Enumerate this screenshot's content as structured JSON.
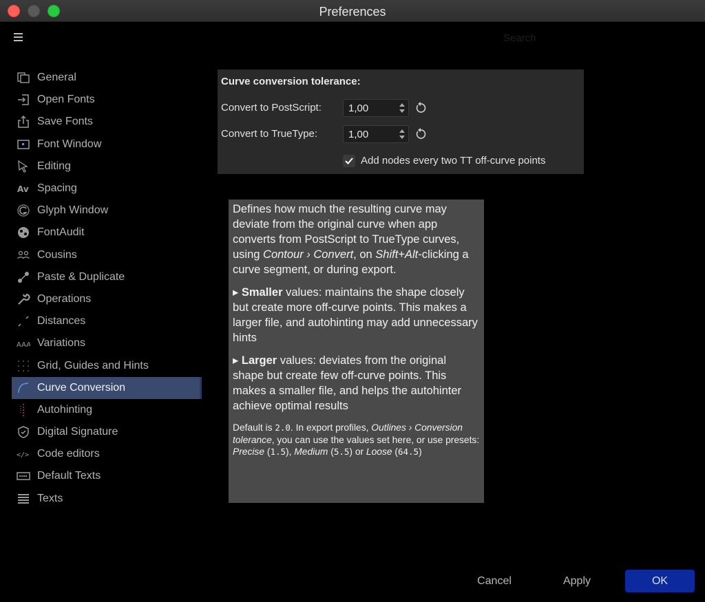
{
  "window": {
    "title": "Preferences"
  },
  "search": {
    "placeholder": "Search"
  },
  "sidebar": {
    "items": [
      {
        "label": "General",
        "icon": "general-icon"
      },
      {
        "label": "Open Fonts",
        "icon": "open-fonts-icon"
      },
      {
        "label": "Save Fonts",
        "icon": "save-fonts-icon"
      },
      {
        "label": "Font Window",
        "icon": "font-window-icon"
      },
      {
        "label": "Editing",
        "icon": "editing-icon"
      },
      {
        "label": "Spacing",
        "icon": "spacing-icon"
      },
      {
        "label": "Glyph Window",
        "icon": "glyph-window-icon"
      },
      {
        "label": "FontAudit",
        "icon": "fontaudit-icon"
      },
      {
        "label": "Cousins",
        "icon": "cousins-icon"
      },
      {
        "label": "Paste & Duplicate",
        "icon": "paste-duplicate-icon"
      },
      {
        "label": "Operations",
        "icon": "wrench-icon"
      },
      {
        "label": "Distances",
        "icon": "distances-icon"
      },
      {
        "label": "Variations",
        "icon": "variations-icon"
      },
      {
        "label": "Grid, Guides and Hints",
        "icon": "grid-icon"
      },
      {
        "label": "Curve Conversion",
        "icon": "curve-conversion-icon",
        "active": true
      },
      {
        "label": "Autohinting",
        "icon": "autohinting-icon"
      },
      {
        "label": "Digital Signature",
        "icon": "shield-check-icon"
      },
      {
        "label": "Code editors",
        "icon": "code-icon"
      },
      {
        "label": "Default Texts",
        "icon": "default-texts-icon"
      },
      {
        "label": "Texts",
        "icon": "texts-icon"
      }
    ]
  },
  "panel": {
    "heading": "Curve conversion tolerance:",
    "postscript": {
      "label": "Convert to PostScript:",
      "value": "1,00"
    },
    "truetype": {
      "label": "Convert to TrueType:",
      "value": "1,00"
    },
    "add_nodes": {
      "label": "Add nodes every two TT off-curve points",
      "checked": true
    }
  },
  "tooltip": {
    "p1_a": "Defines how much the resulting curve may deviate from the original curve when app converts from PostScript to TrueType curves, using ",
    "p1_em1": "Contour › Convert",
    "p1_b": ", on ",
    "p1_em2": "Shift+Alt",
    "p1_c": "-clicking a curve segment, or during export.",
    "p2_bullet": "▸ ",
    "p2_bold": "Smaller",
    "p2_rest": " values: maintains the shape closely but create more off-curve points. This makes a larger file, and autohinting may add unnecessary hints",
    "p3_bullet": "▸ ",
    "p3_bold": "Larger",
    "p3_rest": " values: deviates from the original shape but create few off-curve points. This makes a smaller file, and helps the autohinter achieve optimal results",
    "p4_a": "Default is ",
    "p4_code1": "2.0",
    "p4_b": ". In export profiles, ",
    "p4_em1": "Outlines › Conversion tolerance",
    "p4_c": ", you can use the values set here, or use presets: ",
    "p4_em2": "Precise",
    "p4_d": " (",
    "p4_code2": "1.5",
    "p4_e": "), ",
    "p4_em3": "Medium",
    "p4_f": " (",
    "p4_code3": "5.5",
    "p4_g": ") or ",
    "p4_em4": "Loose",
    "p4_h": " (",
    "p4_code4": "64.5",
    "p4_i": ")"
  },
  "buttons": {
    "cancel": "Cancel",
    "apply": "Apply",
    "ok": "OK"
  },
  "colors": {
    "accent": "#0c2a9e",
    "active_item": "#3a4a6e",
    "tooltip_bg": "#4a4a4a",
    "panel_bg": "#2a2a2a"
  }
}
